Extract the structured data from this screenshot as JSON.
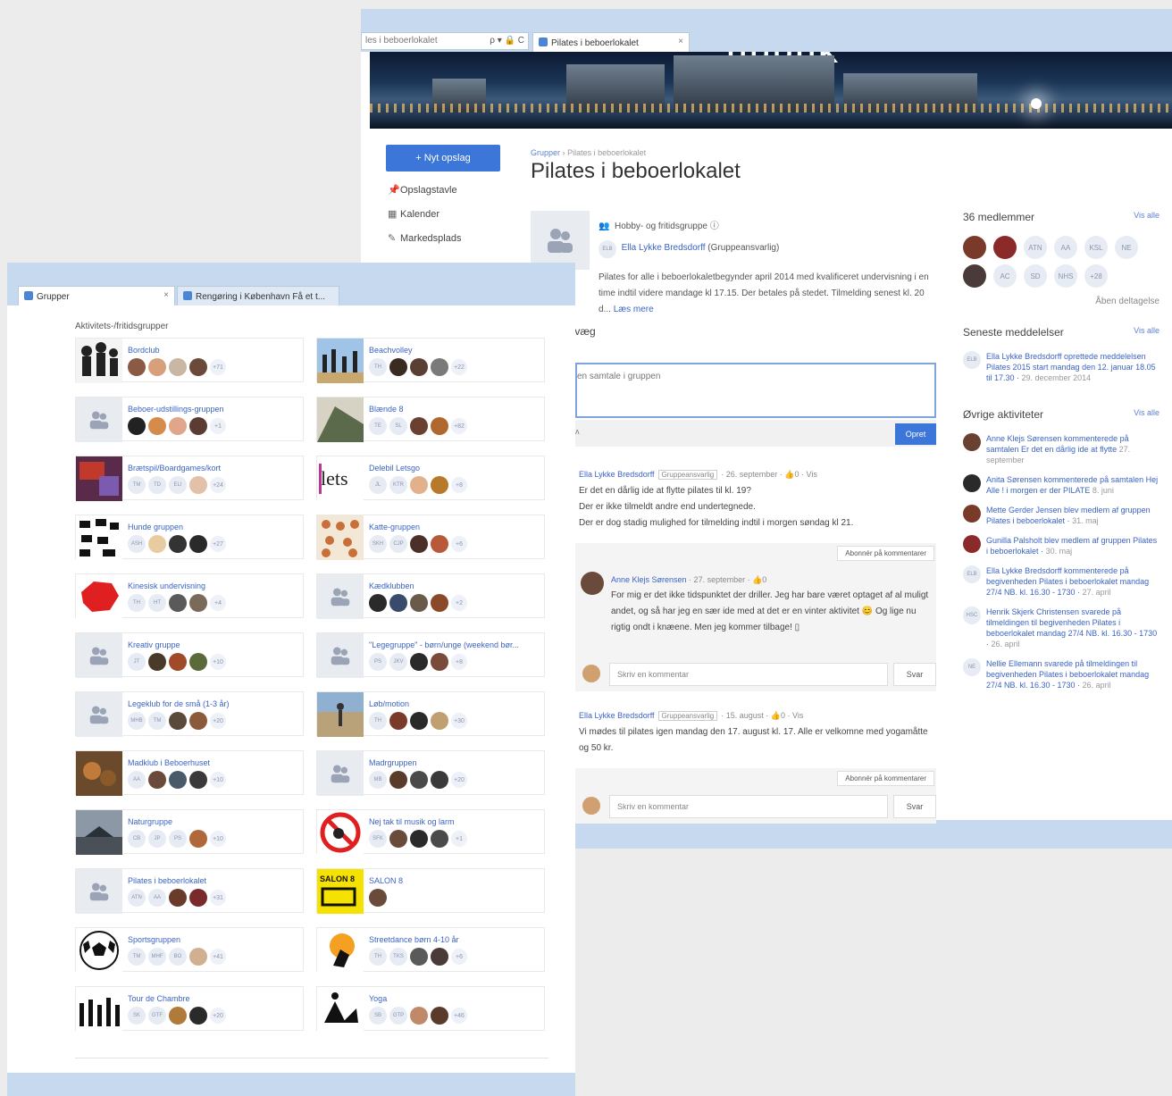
{
  "back_window": {
    "address_text": "les i beboerlokalet",
    "address_tools": "ρ ▾ 🔒 C",
    "tab_title": "Pilates i beboerlokalet",
    "banner_sign": "UDDUK",
    "new_post_button": "+ Nyt opslag",
    "nav": [
      {
        "icon": "pin-icon",
        "glyph": "📌",
        "label": "Opslagstavle"
      },
      {
        "icon": "calendar-icon",
        "glyph": "▦",
        "label": "Kalender"
      },
      {
        "icon": "tag-icon",
        "glyph": "✎",
        "label": "Markedsplads"
      }
    ],
    "breadcrumb": {
      "root": "Grupper",
      "sep": "›",
      "current": "Pilates i beboerlokalet"
    },
    "page_title": "Pilates i beboerlokalet",
    "group_type": "Hobby- og fritidsgruppe ⓘ",
    "owner_initials": "ELB",
    "owner_name": "Ella Lykke Bredsdorff",
    "owner_role": "(Gruppeansvarlig)",
    "description": "Pilates for alle i beboerlokaletbegynder april 2014 med kvalificeret undervisning i en time indtil videre mandage kl 17.15. Der betales på stedet. Tilmelding senest kl. 20 d...",
    "read_more": "Læs mere",
    "wall_label": "r væg",
    "members_title": "36 medlemmer",
    "see_all": "Vis alle",
    "member_initials": [
      "ATN",
      "AA",
      "KSL",
      "NE",
      "AC",
      "SD",
      "NHS",
      "+28"
    ],
    "open_members": "Åben deltagelse",
    "latest_title": "Seneste meddelelser",
    "latest": [
      {
        "initials": "ELB",
        "text": "Ella Lykke Bredsdorff oprettede meddelelsen Pilates 2015 start mandag den 12. januar 18.05 til 17.30 ·",
        "date": "29. december 2014"
      }
    ],
    "other_title": "Øvrige aktiviteter",
    "activities": [
      {
        "text": "Anne Klejs Sørensen kommenterede på samtalen Er det en dårlig ide at flytte",
        "date": "27. september"
      },
      {
        "text": "Anita Sørensen kommenterede på samtalen Hej Alle ! i morgen er der PILATE",
        "date": "8. juni"
      },
      {
        "text": "Mette Gerder Jensen blev medlem af gruppen Pilates i beboerlokalet ·",
        "date": "31. maj"
      },
      {
        "text": "Gunilla Palsholt blev medlem af gruppen Pilates i beboerlokalet ·",
        "date": "30. maj"
      },
      {
        "text": "Ella Lykke Bredsdorff kommenterede på begivenheden Pilates i beboerlokalet mandag 27/4 NB. kl. 16.30 - 1730 ·",
        "date": "27. april"
      },
      {
        "text": "Henrik Skjerk Christensen svarede på tilmeldingen til begivenheden Pilates i beboerlokalet mandag 27/4 NB. kl. 16.30 - 1730 ·",
        "date": "26. april"
      },
      {
        "text": "Nellie Ellemann svarede på tilmeldingen til begivenheden Pilates i beboerlokalet mandag 27/4 NB. kl. 16.30 - 1730 ·",
        "date": "26. april"
      }
    ],
    "activity_initials": [
      "",
      "",
      "",
      "",
      "ELB",
      "HSC",
      "NE"
    ]
  },
  "wall": {
    "composer_placeholder": "en samtale i gruppen",
    "composer_left": "ʌ",
    "publish": "Opret",
    "subscribe": "Abonnér på kommentarer",
    "comment_placeholder": "Skriv en kommentar",
    "reply_button": "Svar",
    "posts": [
      {
        "author": "Ella Lykke Bredsdorff",
        "badge": "Gruppeansvarlig",
        "meta": "· 26. september · 👍0 · Vis",
        "lines": [
          "Er det en dårlig ide at flytte pilates til kl. 19?",
          "Der er ikke tilmeldt andre end undertegnede.",
          "Der er dog stadig mulighed for tilmelding indtil i morgen søndag kl 21."
        ]
      },
      {
        "author": "Ella Lykke Bredsdorff",
        "badge": "Gruppeansvarlig",
        "meta": "· 15. august · 👍0 · Vis",
        "lines": [
          "Vi mødes til pilates igen mandag den 17. august kl. 17. Alle er velkomne med yogamåtte og 50 kr."
        ]
      }
    ],
    "reply": {
      "author": "Anne Klejs Sørensen",
      "meta": "· 27. september · 👍0",
      "text": "For mig er det ikke tidspunktet der driller. Jeg har bare været optaget af al muligt andet, og så har jeg en sær ide med at det er en vinter aktivitet 😊 Og lige nu rigtig ondt i knæene. Men jeg kommer tilbage! ▯"
    }
  },
  "front_window": {
    "tab1": "Grupper",
    "tab2": "Rengøring i København Få et t...",
    "section_title": "Aktivitets-/fritidsgrupper",
    "groups": [
      {
        "name": "Bordclub",
        "img": "people",
        "avs": [
          "#8a5a44",
          "#d7a07a",
          "#c9b7a3",
          "#6b4a3a"
        ],
        "ini": [],
        "more": "+71"
      },
      {
        "name": "Beachvolley",
        "img": "beach",
        "avs": [
          "#3a2b22",
          "#5a4034",
          "#7a7a7a"
        ],
        "ini": [
          "TH"
        ],
        "more": "+22"
      },
      {
        "name": "Beboer-udstillings-gruppen",
        "img": "ph",
        "avs": [
          "#222",
          "#d58b4b",
          "#e0a58a",
          "#5a3c33"
        ],
        "ini": [],
        "more": "+1"
      },
      {
        "name": "Blænde 8",
        "img": "photo",
        "avs": [
          "#6a4030",
          "#b0682e"
        ],
        "ini": [
          "TE",
          "SL"
        ],
        "more": "+82"
      },
      {
        "name": "Brætspil/Boardgames/kort",
        "img": "board",
        "avs": [
          "#e2c1a8"
        ],
        "ini": [
          "TM",
          "TD",
          "ELI"
        ],
        "more": "+24"
      },
      {
        "name": "Delebil Letsgo",
        "img": "lets",
        "avs": [
          "#e2b08a",
          "#b87a2a"
        ],
        "ini": [
          "JL",
          "KTR"
        ],
        "more": "+8"
      },
      {
        "name": "Hunde gruppen",
        "img": "dogs",
        "avs": [
          "#e8cba0",
          "#333",
          "#2a2a2a"
        ],
        "ini": [
          "ASH"
        ],
        "more": "+27"
      },
      {
        "name": "Katte-gruppen",
        "img": "cats",
        "avs": [
          "#4a3028",
          "#b85a3a"
        ],
        "ini": [
          "SKH",
          "CJP"
        ],
        "more": "+6"
      },
      {
        "name": "Kinesisk undervisning",
        "img": "china",
        "avs": [
          "#5a5a5a",
          "#7a6a5a"
        ],
        "ini": [
          "TH",
          "HT"
        ],
        "more": "+4"
      },
      {
        "name": "Kædklubben",
        "img": "ph",
        "avs": [
          "#2a2a2a",
          "#3a4a6a",
          "#6a5a4a",
          "#8a4a2a"
        ],
        "ini": [],
        "more": "+2"
      },
      {
        "name": "Kreativ gruppe",
        "img": "ph",
        "avs": [
          "#4a3a2a",
          "#a04a2a",
          "#5a6a3a"
        ],
        "ini": [
          "JT"
        ],
        "more": "+10"
      },
      {
        "name": "\"Legegruppe\" - børn/unge (weekend bør...",
        "img": "ph",
        "avs": [
          "#2a2a2a",
          "#7a4a3a"
        ],
        "ini": [
          "PS",
          "JKV"
        ],
        "more": "+8"
      },
      {
        "name": "Legeklub for de små (1-3 år)",
        "img": "ph",
        "avs": [
          "#5a4a3a",
          "#8a5a3a"
        ],
        "ini": [
          "MHB",
          "TM"
        ],
        "more": "+20"
      },
      {
        "name": "Løb/motion",
        "img": "run",
        "avs": [
          "#7a3a2a",
          "#2a2a2a",
          "#c0a070"
        ],
        "ini": [
          "TH"
        ],
        "more": "+30"
      },
      {
        "name": "Madklub i Beboerhuset",
        "img": "food",
        "avs": [
          "#6a4a3a",
          "#4a5a6a",
          "#3a3a3a"
        ],
        "ini": [
          "AA"
        ],
        "more": "+10"
      },
      {
        "name": "Madrgruppen",
        "img": "ph",
        "avs": [
          "#5a3a2a",
          "#4a4a4a",
          "#3a3a3a"
        ],
        "ini": [
          "MB"
        ],
        "more": "+20"
      },
      {
        "name": "Naturgruppe",
        "img": "nature",
        "avs": [
          "#b0683a"
        ],
        "ini": [
          "CB",
          "JP",
          "PS"
        ],
        "more": "+10"
      },
      {
        "name": "Nej tak til musik og larm",
        "img": "nomusic",
        "avs": [
          "#6a4a3a",
          "#2a2a2a",
          "#4a4a4a"
        ],
        "ini": [
          "SFK"
        ],
        "more": "+1"
      },
      {
        "name": "Pilates i beboerlokalet",
        "img": "ph",
        "avs": [
          "#6a3a2a",
          "#7a2a2a"
        ],
        "ini": [
          "ATN",
          "AA"
        ],
        "more": "+31"
      },
      {
        "name": "SALON 8",
        "img": "salon",
        "avs": [
          "#6a4a3a"
        ],
        "ini": [],
        "more": ""
      },
      {
        "name": "Sportsgruppen",
        "img": "ball",
        "avs": [
          "#d0b090"
        ],
        "ini": [
          "TM",
          "MHF",
          "BO"
        ],
        "more": "+41"
      },
      {
        "name": "Streetdance børn 4-10 år",
        "img": "dance",
        "avs": [
          "#5a5a5a",
          "#4a3a3a"
        ],
        "ini": [
          "TH",
          "TKS"
        ],
        "more": "+6"
      },
      {
        "name": "Tour de Chambre",
        "img": "tour",
        "avs": [
          "#b07a3a",
          "#2a2a2a"
        ],
        "ini": [
          "SK",
          "GTF"
        ],
        "more": "+20"
      },
      {
        "name": "Yoga",
        "img": "yoga",
        "avs": [
          "#c08a6a",
          "#5a3a2a"
        ],
        "ini": [
          "SB",
          "GTP"
        ],
        "more": "+46"
      }
    ]
  },
  "colors": {
    "accent": "#3d76d9",
    "link": "#3b63c4",
    "chrome": "#c7d9ee"
  }
}
